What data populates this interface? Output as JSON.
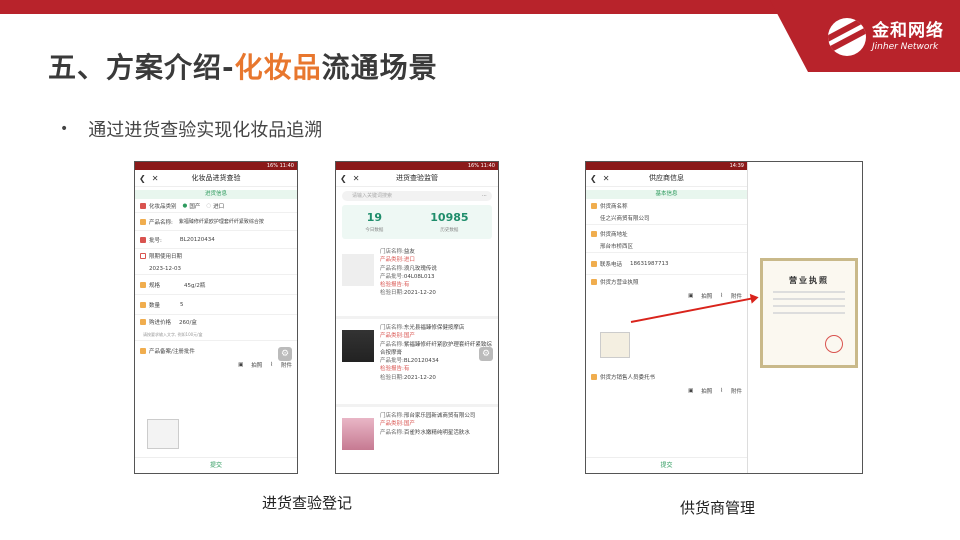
{
  "brand": {
    "cn": "金和网络",
    "en": "Jinher Network"
  },
  "slide": {
    "title_pre": "五、方案介绍-",
    "title_hl": "化妆品",
    "title_post": "流通场景",
    "bullet": "通过进货查验实现化妆品追溯",
    "caption_left": "进货查验登记",
    "caption_right": "供货商管理"
  },
  "phone1": {
    "status": "16% 11:40",
    "title": "化妆品进货查验",
    "banner": "进货信息",
    "category_label": "化妆品类别",
    "opt_domestic": "国产",
    "opt_import": "进口",
    "name_label": "产品名称:",
    "name_value": "紫福臻修纤紧欧护理套纤纤紧致综合按",
    "batch_label": "批号:",
    "batch_value": "BL20120434",
    "expiry_label": "限期使用日期",
    "expiry_value": "2023-12-03",
    "spec_label": "规格",
    "spec_value": "45g/2瓶",
    "qty_label": "数量",
    "qty_value": "5",
    "price_label": "购进价格",
    "price_value": "260/盒",
    "price_hint": "请按要求输入文字, 例如100元/盒",
    "filing_label": "产品备案/注册批件",
    "photo_btn": "拍照",
    "attach_btn": "附件",
    "submit": "提交"
  },
  "phone2": {
    "status": "16% 11:40",
    "title": "进货查验监管",
    "search_placeholder": "请输入关键词搜索",
    "today_count": "19",
    "today_label": "今日数据",
    "history_count": "10985",
    "history_label": "历史数据",
    "records": [
      {
        "store_k": "门店名称:",
        "store": "益友",
        "cat_k": "产品类别:",
        "cat": "进口",
        "name_k": "产品名称:",
        "name": "浪凡玫瑰传说",
        "batch_k": "产品批号:",
        "batch": "04L08L013",
        "report_k": "检验报告:",
        "report": "有",
        "date_k": "检验日期:",
        "date": "2021-12-20"
      },
      {
        "store_k": "门店名称:",
        "store": "东光县福臻修保健按摩店",
        "cat_k": "产品类别:",
        "cat": "国产",
        "name_k": "产品名称:",
        "name": "紫福臻修纤纤紧欧护理套纤纤紧致综合按摩膏",
        "batch_k": "产品批号:",
        "batch": "BL20120434",
        "report_k": "检验报告:",
        "report": "有",
        "date_k": "检验日期:",
        "date": "2021-12-20"
      },
      {
        "store_k": "门店名称:",
        "store": "邢台家乐园新诚商贸有限公司",
        "cat_k": "产品类别:",
        "cat": "国产",
        "name_k": "产品名称:",
        "name": "百雀羚水嫩精纯明星活肤水"
      }
    ]
  },
  "phone3": {
    "status": "14:39",
    "title": "供应商信息",
    "banner": "基本信息",
    "supplier_label": "供货商名称",
    "supplier_value": "佳之兴商贸有限公司",
    "address_label": "供货商地址",
    "address_value": "邢台市桥西区",
    "phone_label": "联系电话",
    "phone_value": "18631987713",
    "license_label": "供货方营业执照",
    "photo_btn": "拍照",
    "attach_btn": "附件",
    "proxy_label": "供货方销售人员委托书",
    "submit": "提交"
  },
  "certificate": {
    "title": "营业执照"
  },
  "colors": {
    "brand_red": "#b8232b",
    "highlight": "#e8772e",
    "green": "#2e9b5e"
  }
}
